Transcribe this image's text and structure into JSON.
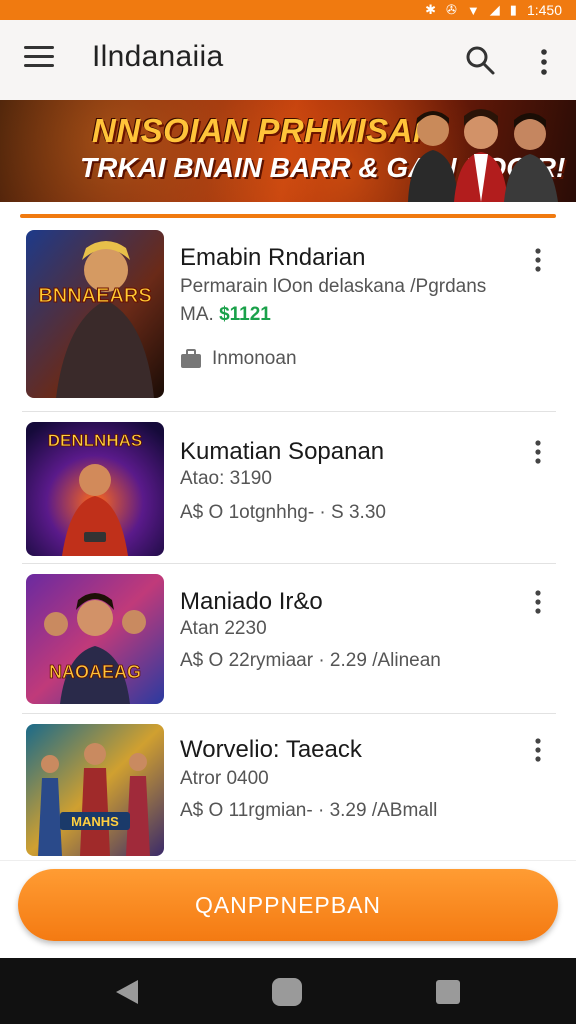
{
  "status_bar": {
    "time": "1:450",
    "icons": [
      "settings-icon",
      "vibrate-icon",
      "wifi-icon",
      "signal-icon",
      "battery-icon"
    ]
  },
  "app_bar": {
    "title": "Ilndanaiia"
  },
  "banner": {
    "line1": "NNSOIAN PRHMISAN",
    "line2": "TRKAI BNAIN BARR & GAIN BOGIR!"
  },
  "items": [
    {
      "title": "Emabin Rndarian",
      "subtitle": "Permarain lOon delaskana /Pgrdans",
      "meta_prefix": "MA.",
      "meta_price": "$1121",
      "tag": "Inmonoan",
      "thumb_text": "BNNAEARS"
    },
    {
      "title": "Kumatian Sopanan",
      "subtitle": "Atao: 3190",
      "meta": "A$ O 1otgnhhg-  · S 3.30",
      "thumb_text": "DENLNHAS"
    },
    {
      "title": "Maniado Ir&o",
      "subtitle": "Atan 2230",
      "meta": "A$ O 22rymiaar  · 2.29 /Alinean",
      "thumb_text": "NAOAEAG"
    },
    {
      "title": "Worvelio: Taeack",
      "subtitle": "Atror 0400",
      "meta": "A$ O 11rgmian-  · 3.29 /ABmall",
      "thumb_text": "MANHS"
    }
  ],
  "cta": {
    "label": "QANPPNEPBAN"
  },
  "colors": {
    "accent": "#f07a10",
    "price": "#1aa14a"
  }
}
